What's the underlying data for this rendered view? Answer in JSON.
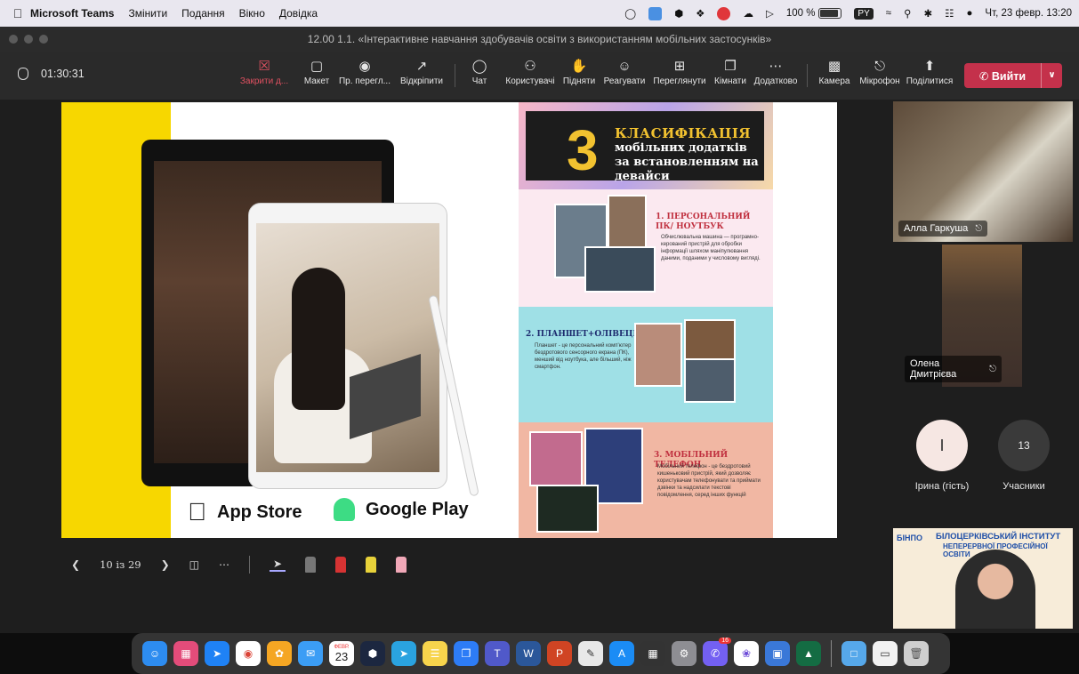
{
  "menubar": {
    "app": "Microsoft Teams",
    "menus": [
      "Змінити",
      "Подання",
      "Вікно",
      "Довідка"
    ],
    "battery": "100 %",
    "input_lang": "PY",
    "clock": "Чт, 23 февр.  13:20"
  },
  "window": {
    "title": "12.00 1.1. «Інтерактивне навчання здобувачів освіти з використанням мобільних застосунків»"
  },
  "toolbar": {
    "timer": "01:30:31",
    "close": "Закрити д...",
    "layout": "Макет",
    "preview": "Пр. перегл...",
    "unpin": "Відкріпити",
    "chat": "Чат",
    "people": "Користувачі",
    "raise": "Підняти",
    "react": "Реагувати",
    "view": "Переглянути",
    "rooms": "Кімнати",
    "more": "Додатково",
    "camera": "Камера",
    "mic": "Мікрофон",
    "share": "Поділитися",
    "leave": "Вийти"
  },
  "slide": {
    "app_store": "App Store",
    "google_play": "Google Play",
    "num": "3",
    "heading": "КЛАСИФІКАЦІЯ",
    "subheading": "мобільних додатків за встановленням на девайси",
    "s1_title": "1. ПЕРСОНАЛЬНИЙ ПК/ НОУТБУК",
    "s1_body": "Обчислювальна машина — програмно-керований пристрій для обробки інформації шляхом маніпулювання даними, поданими у числовому вигляді.",
    "s2_title": "2. ПЛАНШЕТ+ОЛІВЕЦЬ",
    "s2_body": "Планшет - це персональний комп'ютер бездротового сенсорного екрана (ПК), менший від ноутбука, але більший, ніж смартфон.",
    "s3_title": "3. МОБІЛЬНИЙ ТЕЛЕФОН",
    "s3_body": "Мобільний телефон - це бездротовий кишеньковий пристрій, який дозволяє користувачам телефонувати та приймати дзвінки та надсилати текстові повідомлення, серед інших функцій"
  },
  "presenter": {
    "page": "10 із 29"
  },
  "participants": {
    "p1": "Алла Гаркуша",
    "p2": "Олена Дмитрієва",
    "p3_initial": "І",
    "p3": "Ірина (гість)",
    "count": "13",
    "count_label": "Учасники",
    "banner_logo": "БІНПО",
    "banner_title": "БІЛОЦЕРКІВСЬКИЙ ІНСТИТУТ",
    "banner_sub": "НЕПЕРЕРВНОЇ ПРОФЕСІЙНОЇ ОСВІТИ"
  },
  "dock": {
    "calendar_month": "ФЕВР.",
    "calendar_day": "23",
    "badge": "16"
  },
  "colors": {
    "leave": "#c4314b",
    "slide_yellow": "#f7d700",
    "accent_red": "#e05161"
  }
}
